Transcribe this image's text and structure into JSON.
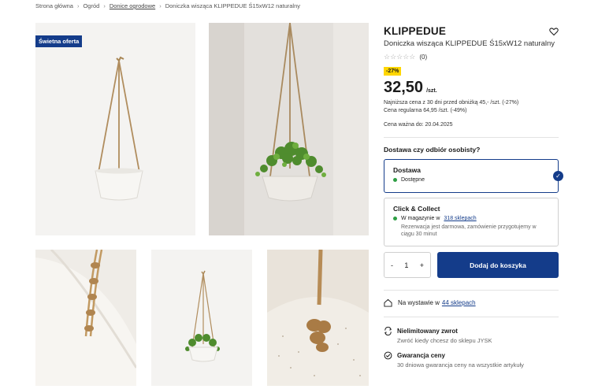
{
  "breadcrumb": {
    "items": [
      "Strona główna",
      "Ogród",
      "Donice ogrodowe",
      "Doniczka wisząca KLIPPEDUE Ś15xW12 naturalny"
    ],
    "sep": "›"
  },
  "gallery": {
    "badge": "Świetna oferta"
  },
  "product": {
    "brand": "KLIPPEDUE",
    "name": "Doniczka wisząca KLIPPEDUE Ś15xW12 naturalny",
    "rating_stars": "☆☆☆☆☆",
    "rating_count": "(0)",
    "discount": "-27%",
    "price": "32,50",
    "unit": "/szt.",
    "lowest_price": "Najniższa cena z 30 dni przed obniżką 45,- /szt. (-27%)",
    "regular_price": "Cena regularna 64,95 /szt. (-49%)",
    "valid_until": "Cena ważna do: 20.04.2025"
  },
  "delivery": {
    "question": "Dostawa czy odbiór osobisty?",
    "option_delivery": {
      "title": "Dostawa",
      "status": "Dostępne"
    },
    "option_cc": {
      "title": "Click & Collect",
      "status_prefix": "W magazynie w",
      "status_link": "318 sklepach",
      "note": "Rezerwacja jest darmowa, zamówienie przygotujemy w ciągu 30 minut"
    }
  },
  "cart": {
    "minus": "-",
    "quantity": "1",
    "plus": "+",
    "add_label": "Dodaj do koszyka"
  },
  "display": {
    "prefix": "Na wystawie w",
    "link": "44 sklepach"
  },
  "features": [
    {
      "title": "Nielimitowany zwrot",
      "desc": "Zwróć kiedy chcesz do sklepu JYSK",
      "icon": "return-icon"
    },
    {
      "title": "Gwarancja ceny",
      "desc": "30 dniowa gwarancja ceny na wszystkie artykuły",
      "icon": "guarantee-icon"
    }
  ],
  "colors": {
    "accent": "#143c8a",
    "badge_yellow": "#ffd600",
    "available": "#2e9e44"
  }
}
